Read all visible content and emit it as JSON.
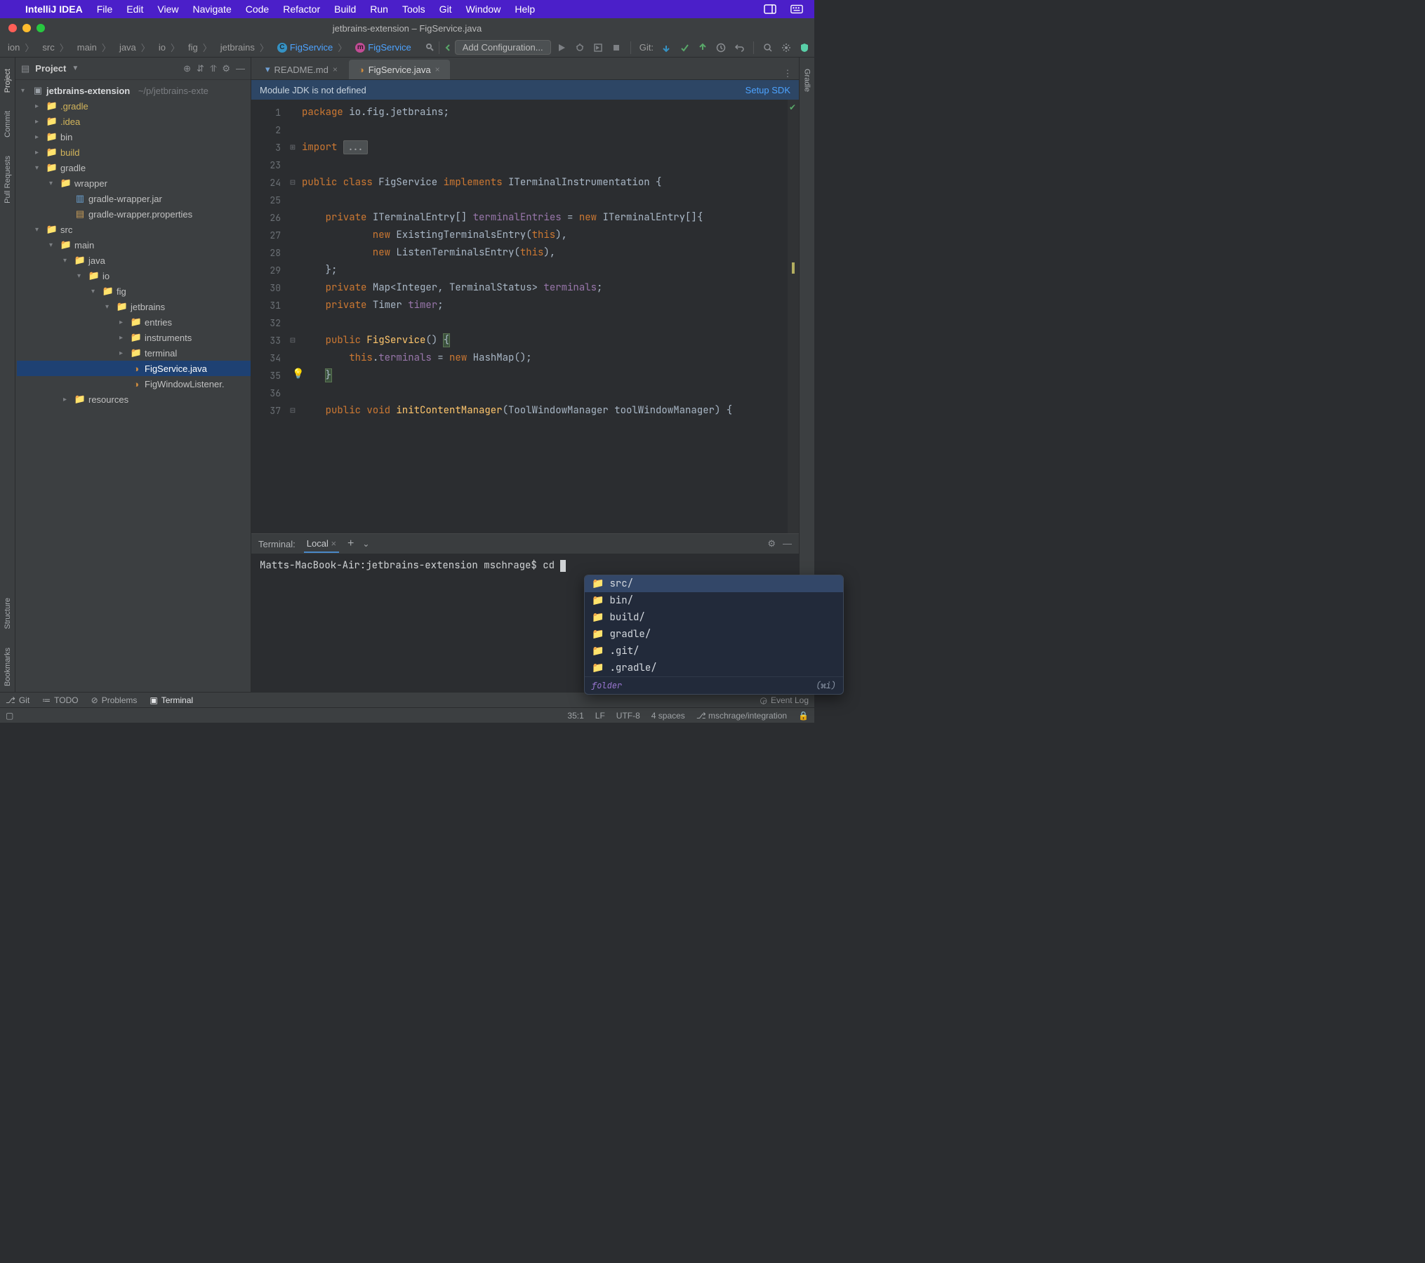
{
  "mac_menu": {
    "app": "IntelliJ IDEA",
    "items": [
      "File",
      "Edit",
      "View",
      "Navigate",
      "Code",
      "Refactor",
      "Build",
      "Run",
      "Tools",
      "Git",
      "Window",
      "Help"
    ]
  },
  "window_title": "jetbrains-extension – FigService.java",
  "breadcrumbs": [
    "ion",
    "src",
    "main",
    "java",
    "io",
    "fig",
    "jetbrains"
  ],
  "crumb_class": "FigService",
  "crumb_method": "FigService",
  "config_button": "Add Configuration...",
  "git_label": "Git:",
  "left_sidebar": [
    "Project",
    "Commit",
    "Pull Requests"
  ],
  "right_sidebar": [
    "Gradle"
  ],
  "project": {
    "label": "Project",
    "root": "jetbrains-extension",
    "root_path": "~/p/jetbrains-exte",
    "tree": [
      {
        "d": 1,
        "arrow": ">",
        "icon": "folder",
        "name": ".gradle",
        "cls": "hl"
      },
      {
        "d": 1,
        "arrow": ">",
        "icon": "folder",
        "name": ".idea",
        "cls": "hl"
      },
      {
        "d": 1,
        "arrow": ">",
        "icon": "folder",
        "name": "bin"
      },
      {
        "d": 1,
        "arrow": ">",
        "icon": "folder",
        "name": "build",
        "cls": "hl"
      },
      {
        "d": 1,
        "arrow": "v",
        "icon": "folder",
        "name": "gradle"
      },
      {
        "d": 2,
        "arrow": "v",
        "icon": "folder",
        "name": "wrapper"
      },
      {
        "d": 3,
        "arrow": "",
        "icon": "jar",
        "name": "gradle-wrapper.jar"
      },
      {
        "d": 3,
        "arrow": "",
        "icon": "props",
        "name": "gradle-wrapper.properties"
      },
      {
        "d": 1,
        "arrow": "v",
        "icon": "folder",
        "name": "src"
      },
      {
        "d": 2,
        "arrow": "v",
        "icon": "folder",
        "name": "main"
      },
      {
        "d": 3,
        "arrow": "v",
        "icon": "folder",
        "name": "java"
      },
      {
        "d": 4,
        "arrow": "v",
        "icon": "folder",
        "name": "io"
      },
      {
        "d": 5,
        "arrow": "v",
        "icon": "folder",
        "name": "fig"
      },
      {
        "d": 6,
        "arrow": "v",
        "icon": "folder",
        "name": "jetbrains"
      },
      {
        "d": 7,
        "arrow": ">",
        "icon": "folder",
        "name": "entries"
      },
      {
        "d": 7,
        "arrow": ">",
        "icon": "folder",
        "name": "instruments"
      },
      {
        "d": 7,
        "arrow": ">",
        "icon": "folder",
        "name": "terminal"
      },
      {
        "d": 7,
        "arrow": "",
        "icon": "java",
        "name": "FigService.java",
        "selected": true
      },
      {
        "d": 7,
        "arrow": "",
        "icon": "java",
        "name": "FigWindowListener."
      },
      {
        "d": 3,
        "arrow": ">",
        "icon": "folder",
        "name": "resources"
      }
    ]
  },
  "editor": {
    "tabs": [
      {
        "name": "README.md",
        "active": false,
        "icon": "md"
      },
      {
        "name": "FigService.java",
        "active": true,
        "icon": "java"
      }
    ],
    "banner": "Module JDK is not defined",
    "banner_action": "Setup SDK",
    "line_numbers": [
      "1",
      "2",
      "3",
      "23",
      "24",
      "25",
      "26",
      "27",
      "28",
      "29",
      "30",
      "31",
      "32",
      "33",
      "34",
      "35",
      "36",
      "37"
    ],
    "lines": [
      [
        {
          "t": "package ",
          "c": "kw"
        },
        {
          "t": "io.fig.jetbrains",
          "c": "typ"
        },
        {
          "t": ";",
          "c": "typ"
        }
      ],
      [],
      [
        {
          "t": "import ",
          "c": "kw"
        },
        {
          "t": "...",
          "c": "folded"
        }
      ],
      [],
      [
        {
          "t": "public class ",
          "c": "kw"
        },
        {
          "t": "FigService ",
          "c": "typ"
        },
        {
          "t": "implements ",
          "c": "kw"
        },
        {
          "t": "ITerminalInstrumentation {",
          "c": "typ"
        }
      ],
      [],
      [
        {
          "t": "    private ",
          "c": "kw"
        },
        {
          "t": "ITerminalEntry[] ",
          "c": "typ"
        },
        {
          "t": "terminalEntries",
          "c": "ident"
        },
        {
          "t": " = ",
          "c": "typ"
        },
        {
          "t": "new ",
          "c": "kw"
        },
        {
          "t": "ITerminalEntry[]{",
          "c": "typ"
        }
      ],
      [
        {
          "t": "            new ",
          "c": "kw"
        },
        {
          "t": "ExistingTerminalsEntry(",
          "c": "typ"
        },
        {
          "t": "this",
          "c": "kw"
        },
        {
          "t": "),",
          "c": "typ"
        }
      ],
      [
        {
          "t": "            new ",
          "c": "kw"
        },
        {
          "t": "ListenTerminalsEntry(",
          "c": "typ"
        },
        {
          "t": "this",
          "c": "kw"
        },
        {
          "t": "),",
          "c": "typ"
        }
      ],
      [
        {
          "t": "    };",
          "c": "typ"
        }
      ],
      [
        {
          "t": "    private ",
          "c": "kw"
        },
        {
          "t": "Map<Integer, TerminalStatus> ",
          "c": "typ"
        },
        {
          "t": "terminals",
          "c": "ident"
        },
        {
          "t": ";",
          "c": "typ"
        }
      ],
      [
        {
          "t": "    private ",
          "c": "kw"
        },
        {
          "t": "Timer ",
          "c": "typ"
        },
        {
          "t": "timer",
          "c": "ident"
        },
        {
          "t": ";",
          "c": "typ"
        }
      ],
      [],
      [
        {
          "t": "    public ",
          "c": "kw"
        },
        {
          "t": "FigService",
          "c": "fn"
        },
        {
          "t": "() ",
          "c": "typ"
        },
        {
          "t": "{",
          "c": "typ brace-hl"
        }
      ],
      [
        {
          "t": "        this",
          "c": "kw"
        },
        {
          "t": ".",
          "c": "typ"
        },
        {
          "t": "terminals",
          "c": "ident"
        },
        {
          "t": " = ",
          "c": "typ"
        },
        {
          "t": "new ",
          "c": "kw"
        },
        {
          "t": "HashMap();",
          "c": "typ"
        }
      ],
      [
        {
          "t": "    ",
          "c": ""
        },
        {
          "t": "}",
          "c": "typ brace-hl"
        }
      ],
      [],
      [
        {
          "t": "    public void ",
          "c": "kw"
        },
        {
          "t": "initContentManager",
          "c": "fn"
        },
        {
          "t": "(ToolWindowManager toolWindowManager) {",
          "c": "typ"
        }
      ]
    ]
  },
  "terminal": {
    "label": "Terminal:",
    "tab": "Local",
    "prompt": "Matts-MacBook-Air:jetbrains-extension mschrage$ cd ",
    "suggestions": [
      "src/",
      "bin/",
      "build/",
      "gradle/",
      ".git/",
      ".gradle/"
    ],
    "suggest_footer": "folder",
    "suggest_hint": "(⌘i)"
  },
  "bottom_tools": {
    "git": "Git",
    "todo": "TODO",
    "problems": "Problems",
    "terminal": "Terminal",
    "eventlog": "Event Log"
  },
  "status": {
    "pos": "35:1",
    "lf": "LF",
    "enc": "UTF-8",
    "indent": "4 spaces",
    "branch": "mschrage/integration"
  },
  "left_bottom_sidebar": [
    "Structure",
    "Bookmarks"
  ]
}
